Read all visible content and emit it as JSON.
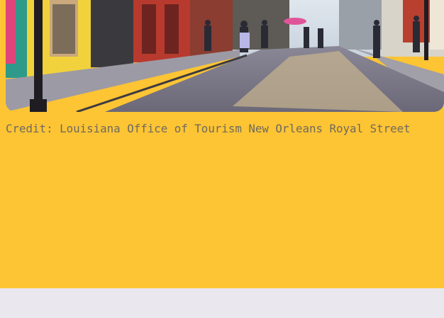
{
  "photo": {
    "subject": "street-scene-photo"
  },
  "caption": {
    "text": "Credit: Louisiana Office of Tourism New Orleans Royal Street"
  },
  "colors": {
    "card_background": "#fdc434",
    "caption_text": "#6f6a5e",
    "page_background": "#eae8ee"
  }
}
